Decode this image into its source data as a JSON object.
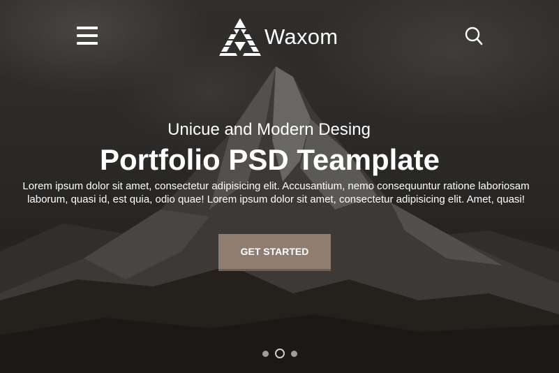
{
  "header": {
    "menu_icon": "hamburger-menu-icon",
    "logo_text": "Waxom",
    "search_icon": "search-icon"
  },
  "hero": {
    "subtitle": "Unicue and Modern Desing",
    "title": "Portfolio PSD Teamplate",
    "description": "Lorem ipsum dolor sit amet, consectetur adipisicing elit. Accusantium, nemo consequuntur ratione laboriosam laborum, quasi id, est quia, odio quae! Lorem ipsum dolor sit amet, consectetur adipisicing elit. Amet, quasi!",
    "cta_label": "GET STARTED"
  },
  "slider": {
    "dot_count": 3,
    "active_index": 1
  },
  "colors": {
    "cta_background": "#8f7e70",
    "text": "#ffffff"
  }
}
